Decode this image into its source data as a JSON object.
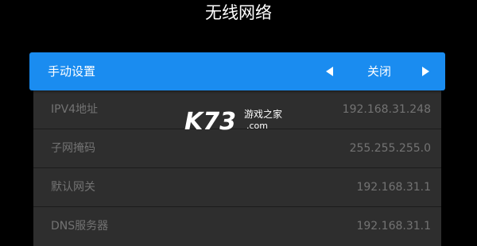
{
  "page_title": "无线网络",
  "manual_setting": {
    "label": "手动设置",
    "value": "关闭",
    "prev_icon": "triangle-left-icon",
    "next_icon": "triangle-right-icon"
  },
  "network_info": [
    {
      "label": "IPV4地址",
      "value": "192.168.31.248"
    },
    {
      "label": "子网掩码",
      "value": "255.255.255.0"
    },
    {
      "label": "默认网关",
      "value": "192.168.31.1"
    },
    {
      "label": "DNS服务器",
      "value": "192.168.31.1"
    }
  ],
  "watermark": {
    "brand": "K73",
    "text": "游戏之家",
    "domain": ".com"
  },
  "colors": {
    "background": "#000000",
    "accent": "#1a8cf0",
    "panel": "#2e2e2e",
    "muted_text": "#737373"
  }
}
